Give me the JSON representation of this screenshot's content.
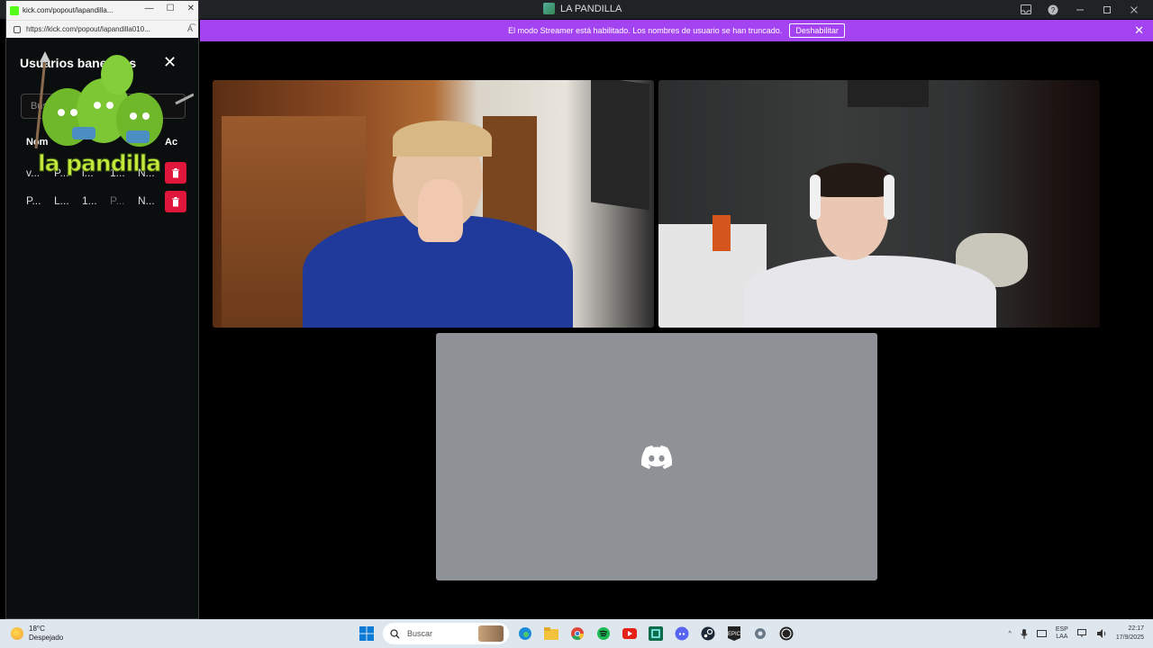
{
  "discord": {
    "title": "LA PANDILLA",
    "streamer_banner": {
      "message": "El modo Streamer está habilitado. Los nombres de usuario se han truncado.",
      "disable_label": "Deshabilitar",
      "close_label": "✕"
    }
  },
  "popout": {
    "tab_title": "kick.com/popout/lapandilla...",
    "url": "https://kick.com/popout/lapandilla010...",
    "heading": "Usuarios baneados",
    "close_label": "✕",
    "search_placeholder": "Buscar",
    "columns": [
      "Nom",
      "Ac"
    ],
    "rows": [
      {
        "cells": [
          "v...",
          "P...",
          "l...",
          "1...",
          "N..."
        ]
      },
      {
        "cells": [
          "P...",
          "L...",
          "1...",
          "P...",
          "N..."
        ]
      }
    ],
    "sticker_text": "la pandilla"
  },
  "taskbar": {
    "weather_temp": "18°C",
    "weather_desc": "Despejado",
    "search_placeholder": "Buscar",
    "lang_line1": "ESP",
    "lang_line2": "LAA",
    "time": "22:17",
    "date": "17/9/2025"
  },
  "colors": {
    "streamer_banner": "#a443f2",
    "kick_green": "#53fc18",
    "trash_red": "#e0163c",
    "discord_tile": "#8e9297"
  }
}
